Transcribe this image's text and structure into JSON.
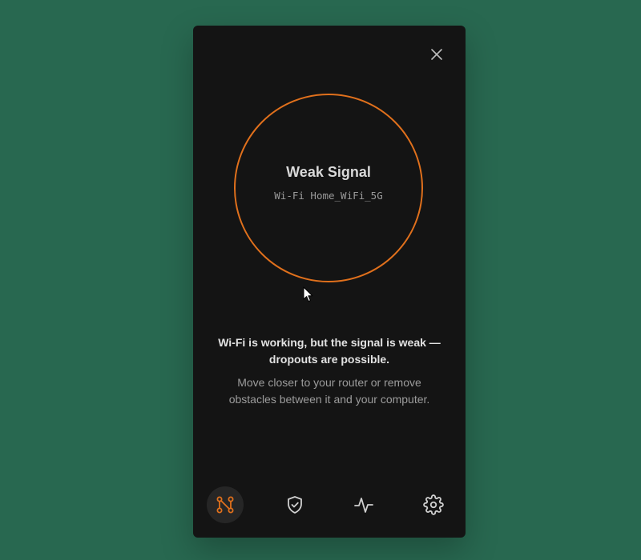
{
  "status": {
    "title": "Weak Signal",
    "network": "Wi-Fi Home_WiFi_5G"
  },
  "message": {
    "main": "Wi-Fi is working, but the signal is weak — dropouts are possible.",
    "hint": "Move closer to your router or remove obstacles between it and your computer."
  },
  "icons": {
    "close": "close-icon",
    "nav": [
      "network-nodes-icon",
      "shield-check-icon",
      "activity-pulse-icon",
      "gear-icon"
    ]
  },
  "colors": {
    "background": "#286850",
    "panel": "#141414",
    "accent": "#e0701c",
    "active_nav_bg": "#262626",
    "icon_inactive": "#d0d0d0"
  },
  "nav": {
    "active_index": 0
  }
}
